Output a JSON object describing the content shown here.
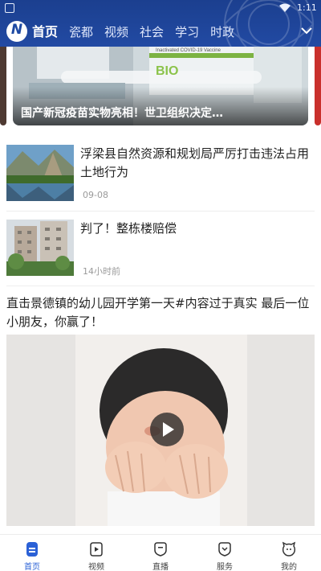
{
  "status_bar": {
    "time": "1:11"
  },
  "header": {
    "logo_text": "N",
    "tabs": [
      {
        "label": "首页",
        "active": true
      },
      {
        "label": "瓷都",
        "active": false
      },
      {
        "label": "视频",
        "active": false
      },
      {
        "label": "社会",
        "active": false
      },
      {
        "label": "学习",
        "active": false
      },
      {
        "label": "时政",
        "active": false
      }
    ],
    "more_icon": "chevron-down-icon"
  },
  "banner": {
    "title": "国产新冠疫苗实物亮相！世卫组织决定…",
    "vial_label": "BIO",
    "vial_text": "Inactivated COVID-19 Vaccine"
  },
  "news": [
    {
      "title": "浮梁县自然资源和规划局严厉打击违法占用土地行为",
      "time": "09-08"
    },
    {
      "title": "判了！整栋楼赔偿",
      "time": "14小时前"
    }
  ],
  "video": {
    "title": "直击景德镇的幼儿园开学第一天#内容过于真实 最后一位小朋友，你赢了！"
  },
  "bottom_nav": [
    {
      "label": "首页",
      "icon": "home-icon",
      "active": true
    },
    {
      "label": "视频",
      "icon": "video-icon",
      "active": false
    },
    {
      "label": "直播",
      "icon": "live-icon",
      "active": false
    },
    {
      "label": "服务",
      "icon": "service-icon",
      "active": false
    },
    {
      "label": "我的",
      "icon": "profile-icon",
      "active": false
    }
  ],
  "colors": {
    "header_blue": "#224aa3",
    "active_nav": "#2b61d6",
    "banner_shade": "#000000"
  }
}
